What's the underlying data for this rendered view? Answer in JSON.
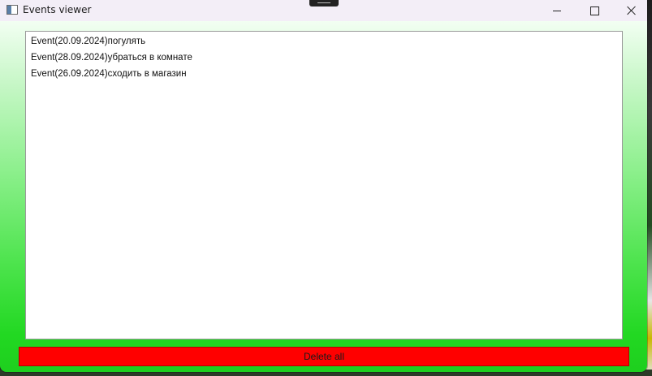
{
  "window": {
    "title": "Events viewer"
  },
  "events": {
    "items": [
      {
        "label": "Event(20.09.2024)погулять"
      },
      {
        "label": "Event(28.09.2024)убраться в комнате"
      },
      {
        "label": "Event(26.09.2024)сходить в магазин"
      }
    ]
  },
  "actions": {
    "delete_all_label": "Delete all"
  },
  "colors": {
    "delete_button": "#ff0000",
    "gradient_top": "#ffffff",
    "gradient_bottom": "#1ecf1e",
    "titlebar": "#f3eef7"
  },
  "icons": {
    "app": "app-window-icon",
    "minimize": "minimize-icon",
    "maximize": "maximize-icon",
    "close": "close-icon"
  }
}
